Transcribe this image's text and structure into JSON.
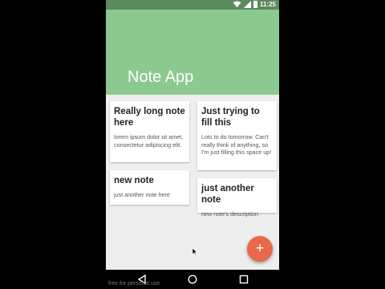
{
  "status_bar": {
    "time": "11:25"
  },
  "appbar": {
    "title": "Note App"
  },
  "notes": [
    {
      "title": "Really long note here",
      "body": "lorem ipsum dolor sit amet, consectetur adipiscing elit."
    },
    {
      "title": "Just trying to fill this",
      "body": "Lots to do tomorrow. Can't really think of anything, so I'm just filling this space up!"
    },
    {
      "title": "new note",
      "body": "just another note here"
    },
    {
      "title": "just another note",
      "body": "new note's description"
    }
  ],
  "fab": {
    "label": "+"
  },
  "watermark": "free for personal use",
  "colors": {
    "appbar": "#8cc98f",
    "status_bar": "#5c8a5e",
    "fab": "#e7694a",
    "background": "#eeeeee"
  },
  "icons": {
    "wifi": "wifi-icon",
    "signal": "signal-icon",
    "battery": "battery-icon",
    "back": "back-icon",
    "home": "home-icon",
    "recents": "recents-icon"
  }
}
